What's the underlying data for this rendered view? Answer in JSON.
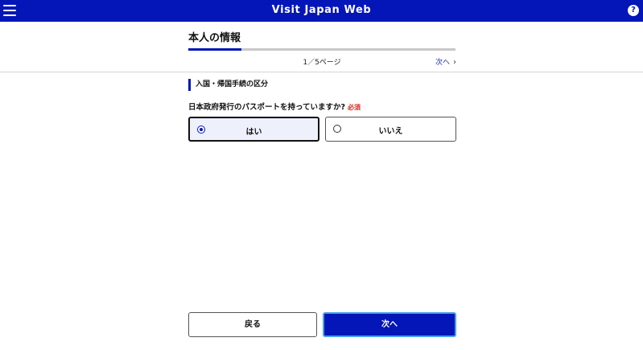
{
  "header": {
    "app_title": "Visit Japan Web",
    "menu_icon": "hamburger-menu-icon",
    "help_icon": "help-icon",
    "help_glyph": "?"
  },
  "form": {
    "page_title": "本人の情報",
    "progress": {
      "current_page": 1,
      "total_pages": 5,
      "fraction": 0.2,
      "indicator": "1／5ページ"
    },
    "next_link": "次へ",
    "next_link_chevron": "›",
    "section_title": "入国・帰国手続の区分",
    "question": "日本政府発行のパスポートを持っていますか?",
    "required_label": "必須",
    "options": [
      {
        "label": "はい",
        "selected": true
      },
      {
        "label": "いいえ",
        "selected": false
      }
    ]
  },
  "footer": {
    "back_label": "戻る",
    "next_label": "次へ"
  },
  "colors": {
    "brand": "#0416b8",
    "required": "#d8261a",
    "selected_bg": "#eef0fb"
  }
}
